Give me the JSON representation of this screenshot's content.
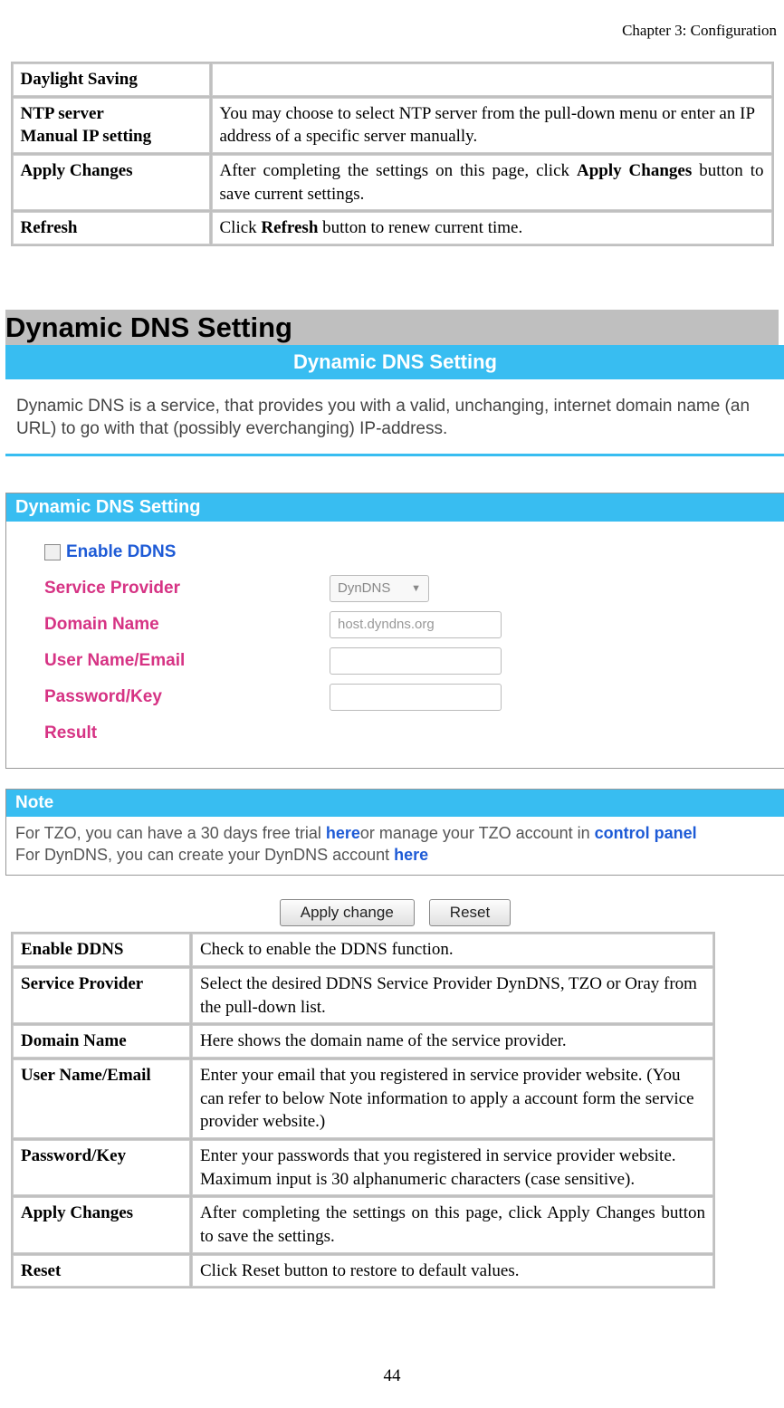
{
  "chapter_header": "Chapter 3: Configuration",
  "top_table": {
    "rows": [
      {
        "key": "Daylight Saving",
        "desc": "",
        "justify": false,
        "bold_words": []
      },
      {
        "key": "NTP server\nManual IP setting",
        "desc": "You may choose to select NTP server from the pull-down menu or enter an IP address of a specific server manually.",
        "justify": false,
        "bold_words": []
      },
      {
        "key": "Apply Changes",
        "desc": "After completing the settings on this page, click Apply Changes button to save current settings.",
        "justify": true,
        "bold_words": [
          "Apply Changes"
        ]
      },
      {
        "key": "Refresh",
        "desc": "Click Refresh button to renew current time.",
        "justify": false,
        "bold_words": [
          "Refresh"
        ]
      }
    ]
  },
  "section_title": "Dynamic DNS Setting",
  "ui": {
    "banner": "Dynamic DNS Setting",
    "intro": "Dynamic DNS is a service, that provides you with a valid, unchanging, internet domain name (an URL) to go with that (possibly everchanging) IP-address.",
    "subhead": "Dynamic DNS Setting",
    "enable_label": "Enable DDNS",
    "fields": {
      "service_provider": {
        "label": "Service Provider",
        "value": "DynDNS"
      },
      "domain_name": {
        "label": "Domain Name",
        "placeholder": "host.dyndns.org"
      },
      "user_name": {
        "label": "User Name/Email",
        "value": ""
      },
      "password": {
        "label": "Password/Key",
        "value": ""
      },
      "result": {
        "label": "Result"
      }
    },
    "note": {
      "head": "Note",
      "line1_a": "For TZO, you can have a 30 days free trial ",
      "line1_link1": "here",
      "line1_b": "or manage your TZO account in ",
      "line1_link2": "control panel",
      "line2_a": "For DynDNS, you can create your DynDNS account ",
      "line2_link": "here"
    },
    "buttons": {
      "apply": "Apply change",
      "reset": "Reset"
    }
  },
  "bottom_table": {
    "rows": [
      {
        "key": "Enable DDNS",
        "desc": "Check to enable the DDNS function.",
        "justify": false
      },
      {
        "key": "Service Provider",
        "desc": "Select the desired DDNS Service Provider DynDNS, TZO or Oray from the pull-down list.",
        "justify": false
      },
      {
        "key": "Domain Name",
        "desc": "Here shows the domain name of the service provider.",
        "justify": false
      },
      {
        "key": "User Name/Email",
        "desc": "Enter your email that you registered in service provider website. (You can refer to below Note information to apply a account form the service provider website.)",
        "justify": false
      },
      {
        "key": "Password/Key",
        "desc": "Enter your passwords that you registered in service provider website. Maximum input is 30 alphanumeric characters (case sensitive).",
        "justify": false
      },
      {
        "key": "Apply Changes",
        "desc": "After completing the settings on this page, click Apply Changes button to save the settings.",
        "justify": true
      },
      {
        "key": "Reset",
        "desc": "Click Reset button to restore to default values.",
        "justify": false
      }
    ]
  },
  "page_number": "44"
}
